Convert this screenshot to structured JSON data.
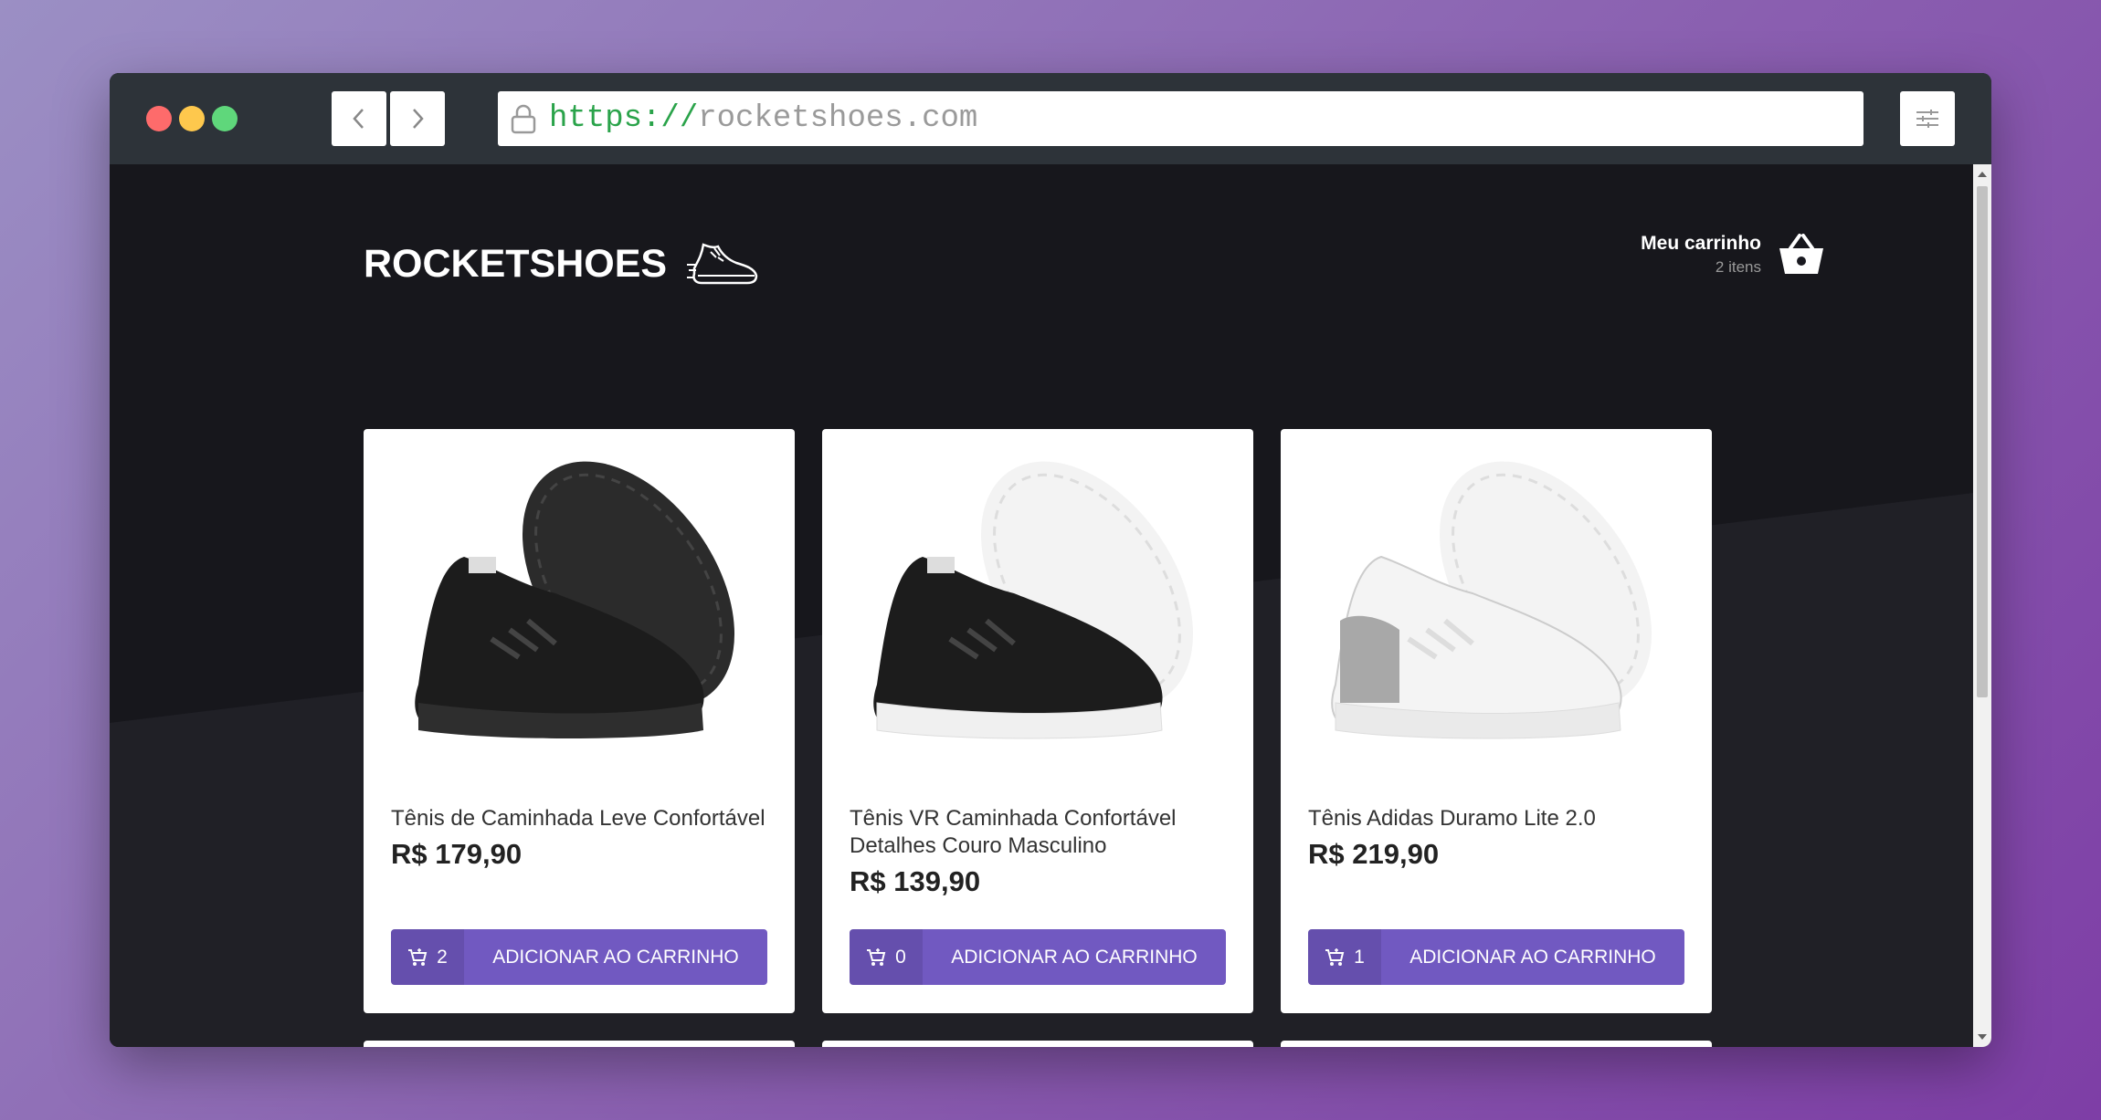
{
  "browser": {
    "url_protocol": "https://",
    "url_host": "rocketshoes.com"
  },
  "header": {
    "logo_text": "ROCKETSHOES",
    "cart_title": "Meu carrinho",
    "cart_count": "2 itens"
  },
  "products": [
    {
      "name": "Tênis de Caminhada Leve Confortável",
      "price": "R$ 179,90",
      "quantity": "2",
      "button_label": "ADICIONAR AO CARRINHO"
    },
    {
      "name": "Tênis VR Caminhada Confortável Detalhes Couro Masculino",
      "price": "R$ 139,90",
      "quantity": "0",
      "button_label": "ADICIONAR AO CARRINHO"
    },
    {
      "name": "Tênis Adidas Duramo Lite 2.0",
      "price": "R$ 219,90",
      "quantity": "1",
      "button_label": "ADICIONAR AO CARRINHO"
    }
  ],
  "colors": {
    "accent": "#7159c1",
    "page_background": "#191920"
  }
}
